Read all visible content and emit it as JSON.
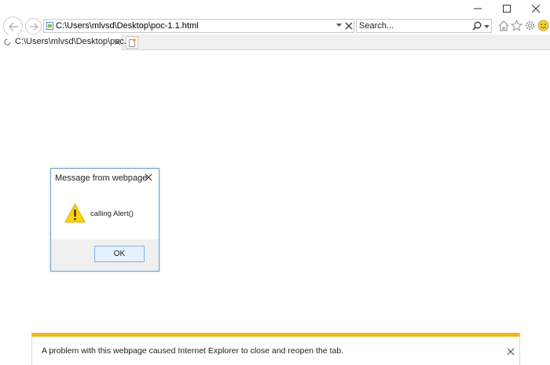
{
  "toolbar": {
    "address_value": "C:\\Users\\mlvsd\\Desktop\\poc-1.1.html",
    "search_placeholder": "Search..."
  },
  "tabs": [
    {
      "label": "C:\\Users\\mlvsd\\Desktop\\poc..."
    }
  ],
  "dialog": {
    "title": "Message from webpage",
    "message": "calling Alert()",
    "ok_label": "OK"
  },
  "notification": {
    "text": "A problem with this webpage caused Internet Explorer to close and reopen the tab."
  },
  "colors": {
    "accent": "#f2b51c",
    "warning_yellow": "#ffd200",
    "dialog_border": "#6fa0d3",
    "button_bg": "#e5f1fb",
    "button_border": "#7eb4ea"
  },
  "icons": {
    "back": "back-arrow-icon",
    "forward": "forward-arrow-icon",
    "page": "page-icon",
    "search": "search-icon",
    "home": "home-icon",
    "favorites": "star-icon",
    "settings": "gear-icon",
    "feedback": "smiley-icon",
    "warning": "warning-icon"
  }
}
